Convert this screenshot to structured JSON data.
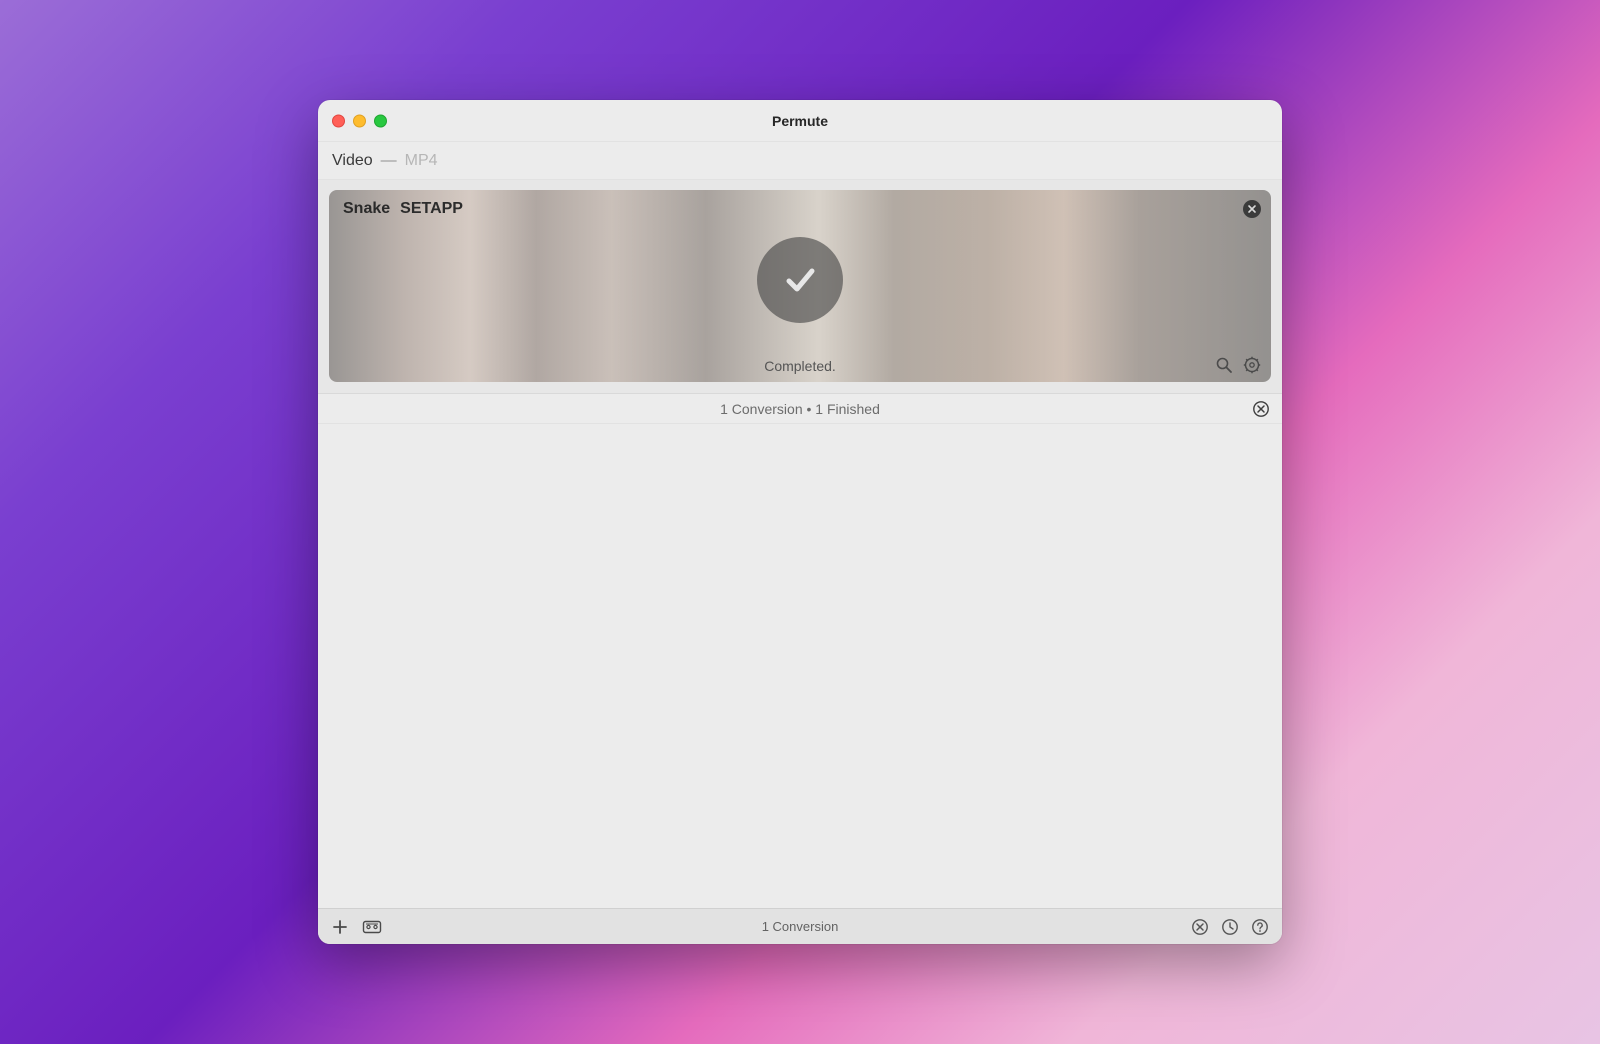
{
  "window": {
    "title": "Permute"
  },
  "format": {
    "type": "Video",
    "separator": "—",
    "name": "MP4"
  },
  "queue": {
    "items": [
      {
        "title_a": "Snake",
        "title_b": "SETAPP",
        "status": "Completed."
      }
    ],
    "summary": "1 Conversion • 1 Finished"
  },
  "footer": {
    "status": "1 Conversion"
  }
}
